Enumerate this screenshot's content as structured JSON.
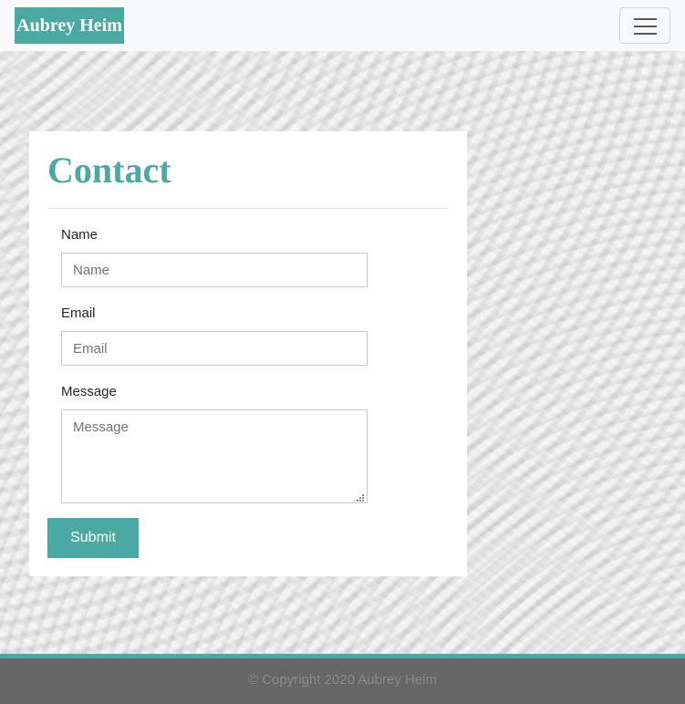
{
  "navbar": {
    "brand": "Aubrey Heim",
    "toggler_icon": "hamburger-menu-icon"
  },
  "contact": {
    "title": "Contact",
    "name_label": "Name",
    "name_placeholder": "Name",
    "email_label": "Email",
    "email_placeholder": "Email",
    "message_label": "Message",
    "message_placeholder": "Message",
    "submit_label": "Submit"
  },
  "footer": {
    "copyright": "© Copyright 2020 Aubrey Heim"
  },
  "colors": {
    "accent": "#4aa9a2",
    "navbar_bg": "#f8f9fa",
    "footer_bg": "#666666"
  }
}
